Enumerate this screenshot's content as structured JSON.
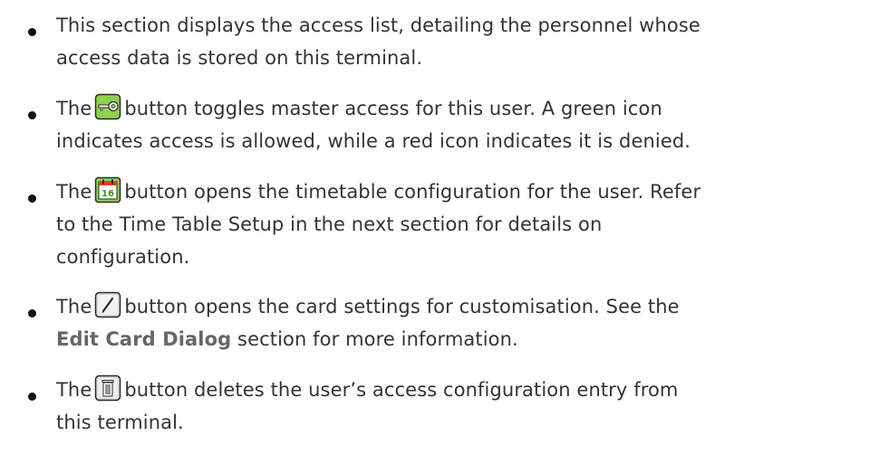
{
  "items": [
    {
      "id": "access-list",
      "line1": "This section displays the access list, detailing the personnel whose",
      "line2": "access data is stored on this terminal."
    },
    {
      "id": "master-access",
      "prefix": "The",
      "icon": "key-icon",
      "line1_after": "button toggles master access for this user. A green icon",
      "line2": "indicates access is allowed, while a red icon indicates it is denied."
    },
    {
      "id": "timetable",
      "prefix": "The",
      "icon": "calendar-icon",
      "icon_label": "16",
      "line1_after": "button opens the timetable configuration for the user. Refer",
      "line2": "to the Time Table Setup in the next section for details on",
      "line3": "configuration."
    },
    {
      "id": "card-settings",
      "prefix": "The",
      "icon": "pencil-icon",
      "line1_after": "button opens the card settings for customisation. See the",
      "line2_link": "Edit Card Dialog",
      "line2_after": " section for more information."
    },
    {
      "id": "delete",
      "prefix": "The",
      "icon": "trash-icon",
      "line1_after": "button deletes the user’s access configuration entry from",
      "line2": "this terminal."
    }
  ],
  "colors": {
    "key_icon_bg": "#8fd14f",
    "calendar_icon_bg": "#8fd14f",
    "calendar_icon_red": "#e63a2e",
    "icon_border": "#2a2a2a",
    "neutral_icon_bg": "#d9d9d9",
    "text": "#333333",
    "link": "#666666"
  }
}
